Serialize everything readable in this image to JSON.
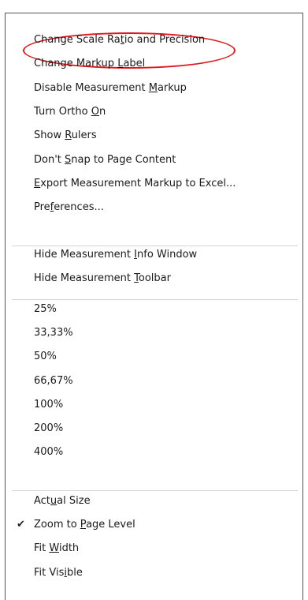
{
  "menu": {
    "groups": [
      {
        "items": [
          {
            "label": "Change Scale Ratio and Precision",
            "mnemonic_index": 15
          },
          {
            "label": "Change Markup Label",
            "mnemonic_index": 14
          },
          {
            "label": "Disable Measurement Markup",
            "mnemonic_index": 20
          },
          {
            "label": "Turn Ortho On",
            "mnemonic_index": 11
          },
          {
            "label": "Show Rulers",
            "mnemonic_index": 5
          },
          {
            "label": "Don't Snap to Page Content",
            "mnemonic_index": 6
          },
          {
            "label": "Export Measurement Markup to Excel...",
            "mnemonic_index": 0
          },
          {
            "label": "Preferences...",
            "mnemonic_index": 3
          }
        ]
      },
      {
        "items": [
          {
            "label": "Hide Measurement Info Window",
            "mnemonic_index": 17
          },
          {
            "label": "Hide Measurement Toolbar",
            "mnemonic_index": 17
          }
        ]
      },
      {
        "items": [
          {
            "label": "25%"
          },
          {
            "label": "33,33%"
          },
          {
            "label": "50%"
          },
          {
            "label": "66,67%"
          },
          {
            "label": "100%"
          },
          {
            "label": "200%"
          },
          {
            "label": "400%"
          }
        ]
      },
      {
        "items": [
          {
            "label": "Actual Size",
            "mnemonic_index": 3
          },
          {
            "label": "Zoom to Page Level",
            "mnemonic_index": 8,
            "checked": true
          },
          {
            "label": "Fit Width",
            "mnemonic_index": 4
          },
          {
            "label": "Fit Visible",
            "mnemonic_index": 7
          }
        ]
      }
    ],
    "check_glyph": "✔",
    "highlight_color": "#e0191e"
  }
}
